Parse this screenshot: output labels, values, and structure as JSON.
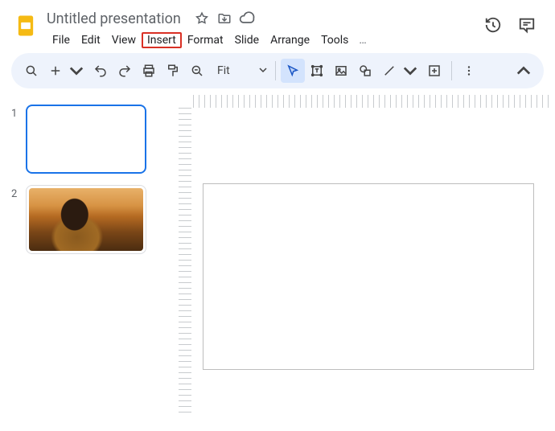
{
  "doc": {
    "title": "Untitled presentation"
  },
  "menus": {
    "file": "File",
    "edit": "Edit",
    "view": "View",
    "insert": "Insert",
    "format": "Format",
    "slide": "Slide",
    "arrange": "Arrange",
    "tools": "Tools",
    "more": "…"
  },
  "toolbar": {
    "fit_label": "Fit"
  },
  "thumbs": [
    {
      "num": "1"
    },
    {
      "num": "2"
    }
  ]
}
